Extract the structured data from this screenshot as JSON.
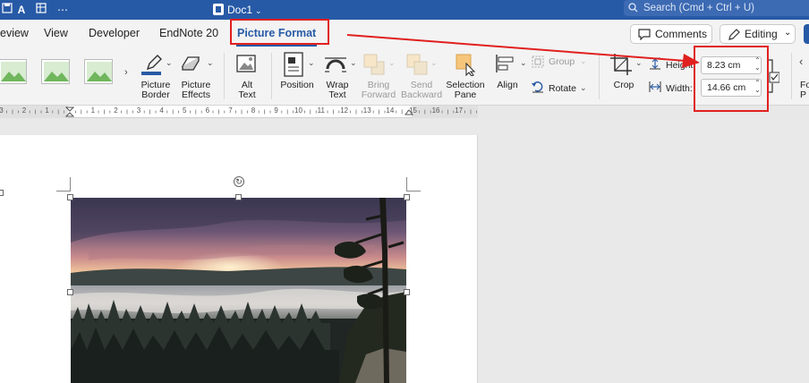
{
  "title_bar": {
    "doc_title": "Doc1",
    "search_placeholder": "Search (Cmd + Ctrl + U)"
  },
  "tabs": [
    {
      "label": "eview"
    },
    {
      "label": "View"
    },
    {
      "label": "Developer"
    },
    {
      "label": "EndNote 20"
    },
    {
      "label": "Picture Format",
      "active": true
    }
  ],
  "header_buttons": {
    "comments_label": "Comments",
    "editing_label": "Editing"
  },
  "ribbon": {
    "picture_border": [
      "Picture",
      "Border"
    ],
    "picture_effects": [
      "Picture",
      "Effects"
    ],
    "alt_text": [
      "Alt",
      "Text"
    ],
    "position": "Position",
    "wrap_text": [
      "Wrap",
      "Text"
    ],
    "bring_forward": [
      "Bring",
      "Forward"
    ],
    "send_backward": [
      "Send",
      "Backward"
    ],
    "selection_pane": [
      "Selection",
      "Pane"
    ],
    "align": "Align",
    "group": "Group",
    "rotate": "Rotate",
    "crop": "Crop",
    "height_label": "Height",
    "height_value": "8.23 cm",
    "width_label": "Width:",
    "width_value": "14.66 cm",
    "format_pane": [
      "Fo",
      "P"
    ]
  },
  "ruler": {
    "numbers": [
      "3",
      "2",
      "1",
      "1",
      "2",
      "3",
      "4",
      "5",
      "6",
      "7",
      "8",
      "9",
      "10",
      "11",
      "12",
      "13",
      "14",
      "15",
      "16",
      "17"
    ]
  },
  "colors": {
    "accent": "#275aa6",
    "annotation_red": "#e0201f"
  }
}
